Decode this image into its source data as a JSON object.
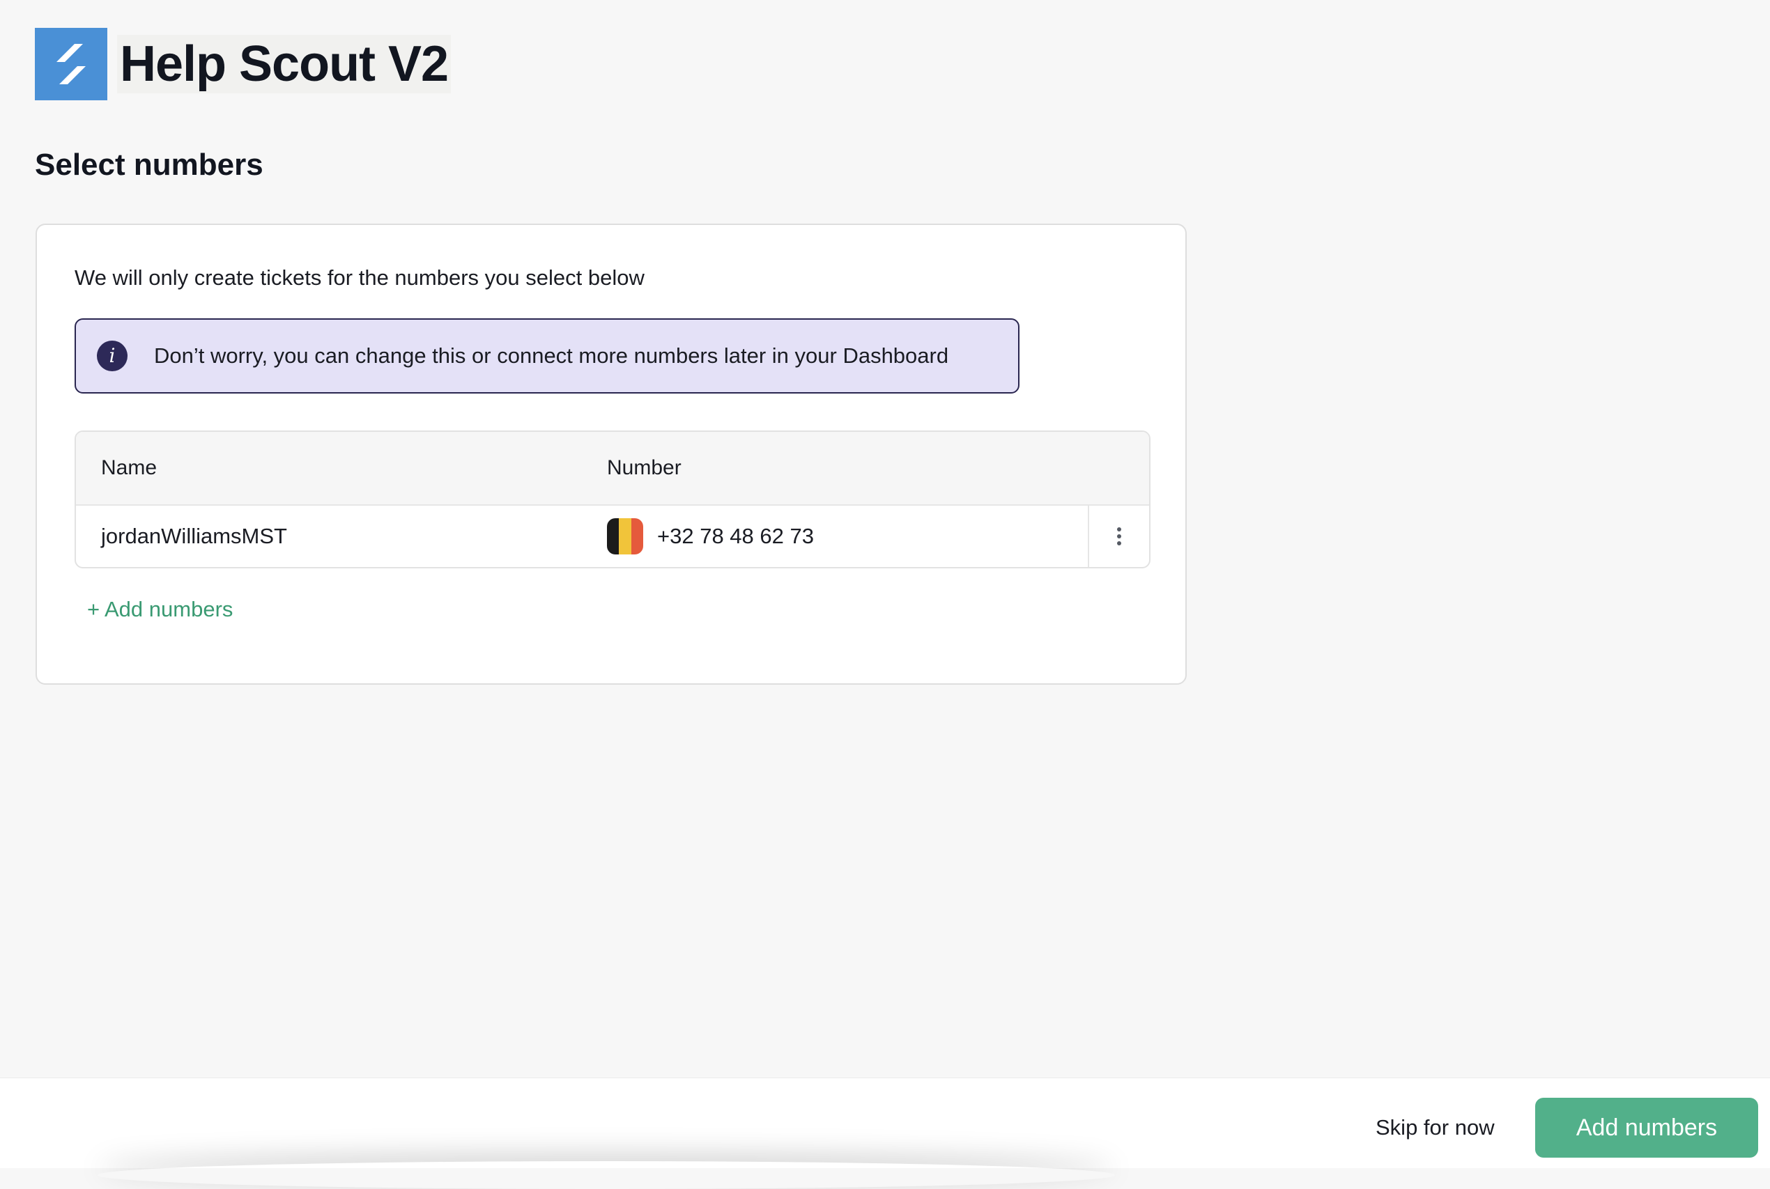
{
  "header": {
    "app_title": "Help Scout V2",
    "logo_icon": "help-scout-logo-icon",
    "logo_color": "#4a90d6"
  },
  "page": {
    "title": "Select numbers"
  },
  "card": {
    "description": "We will only create tickets for the numbers you select below",
    "info_banner": {
      "icon": "info-icon",
      "icon_glyph": "i",
      "text": "Don’t worry, you can change this or connect more numbers later in your Dashboard"
    },
    "table": {
      "columns": {
        "name": "Name",
        "number": "Number"
      },
      "rows": [
        {
          "name": "jordanWilliamsMST",
          "flag_icon": "belgium-flag-icon",
          "flag_colors": [
            "#1b1b1b",
            "#f1c43a",
            "#e55a3c"
          ],
          "number": "+32 78 48 62 73",
          "actions_icon": "more-vertical-icon"
        }
      ]
    },
    "add_link_label": "+ Add numbers"
  },
  "footer": {
    "skip_label": "Skip for now",
    "primary_label": "Add numbers",
    "primary_color": "#52b08a"
  }
}
